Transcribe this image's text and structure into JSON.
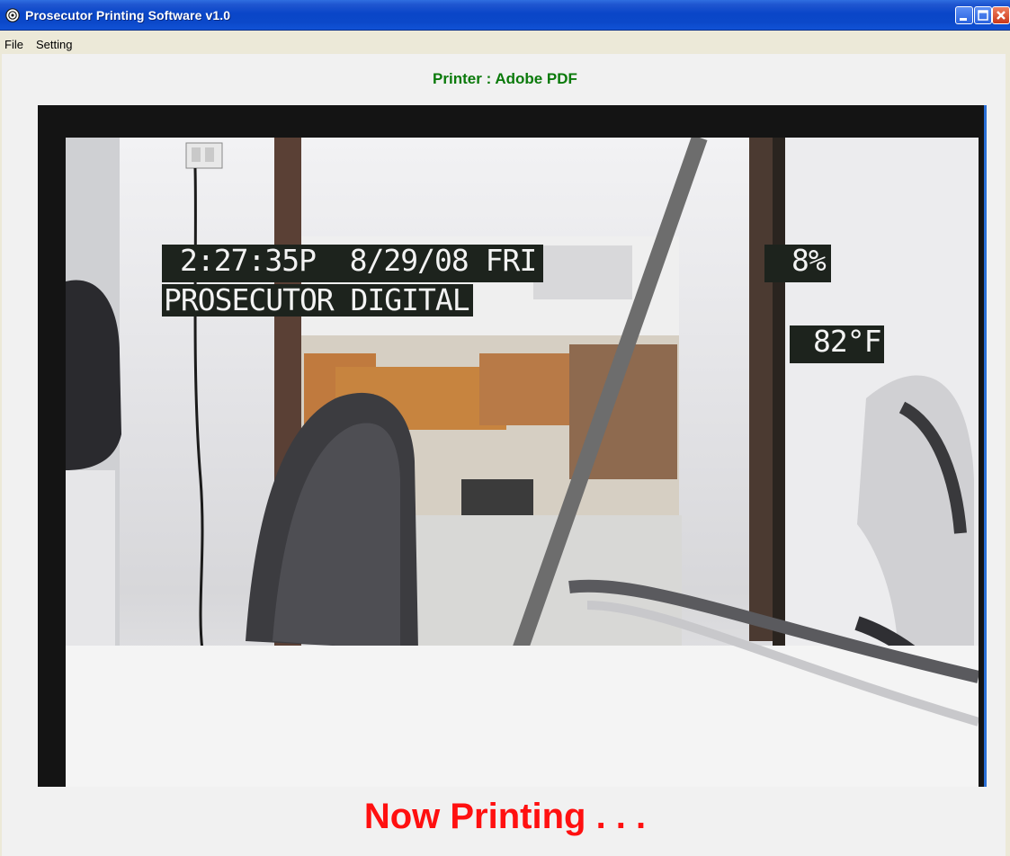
{
  "window": {
    "title": "Prosecutor Printing Software v1.0",
    "app_icon": "app-icon",
    "controls": [
      "minimize-icon",
      "maximize-icon",
      "close-icon"
    ]
  },
  "menu": {
    "items": [
      {
        "label": "File"
      },
      {
        "label": "Setting"
      }
    ]
  },
  "printer": {
    "label": "Printer : Adobe PDF",
    "color": "#0b7a0b"
  },
  "video": {
    "overlay": {
      "time_date": "2:27:35P  8/29/08 FRI",
      "caption": "PROSECUTOR DIGITAL",
      "humidity": "8%",
      "temperature": "82°F"
    }
  },
  "status": {
    "text": "Now Printing . . .",
    "color": "#ff1010"
  }
}
